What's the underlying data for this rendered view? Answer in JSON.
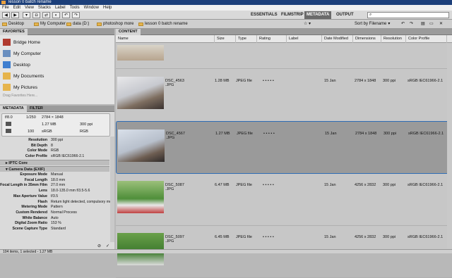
{
  "window": {
    "title": "lesson 0 batch rename"
  },
  "menu": [
    "File",
    "Edit",
    "View",
    "Stacks",
    "Label",
    "Tools",
    "Window",
    "Help"
  ],
  "workspaces": [
    "ESSENTIALS",
    "FILMSTRIP",
    "METADATA",
    "OUTPUT"
  ],
  "active_workspace": "METADATA",
  "sort_label": "Sort by Filename",
  "path": [
    "Desktop",
    "My Computer",
    "data (D:)",
    "photoshop more",
    "lesson 0 batch rename"
  ],
  "favorites": {
    "tab": "FAVORITES",
    "items": [
      "Bridge Home",
      "My Computer",
      "Desktop",
      "My Documents",
      "My Pictures"
    ],
    "hint": "Drag Favorites Here..."
  },
  "metapanel": {
    "tabs": [
      "METADATA",
      "FILTER"
    ],
    "summary": {
      "aperture": "f/8.0",
      "shutter": "1/250",
      "dims": "2784 × 1848",
      "size": "1.27 MB",
      "ppi": "300 ppi",
      "iso": "100",
      "profile": "sRGB",
      "mode": "RGB",
      "ev": "--"
    },
    "file_rows": [
      {
        "k": "Resolution",
        "v": "300 ppi"
      },
      {
        "k": "Bit Depth",
        "v": "8"
      },
      {
        "k": "Color Mode",
        "v": "RGB"
      },
      {
        "k": "Color Profile",
        "v": "sRGB IEC61966-2.1"
      }
    ],
    "iptc": "IPTC Core",
    "camera": "Camera Data (EXIF)",
    "exif_rows": [
      {
        "k": "Exposure Mode",
        "v": "Manual"
      },
      {
        "k": "Focal Length",
        "v": "18.0 mm"
      },
      {
        "k": "Focal Length in 35mm Film",
        "v": "27.0 mm"
      },
      {
        "k": "Lens",
        "v": "18.0-135.0 mm f/3.5-5.6"
      },
      {
        "k": "Max Aperture Value",
        "v": "f/3.5"
      },
      {
        "k": "Flash",
        "v": "Return light detected, compulsory mode"
      },
      {
        "k": "Metering Mode",
        "v": "Pattern"
      },
      {
        "k": "Custom Rendered",
        "v": "Normal Process"
      },
      {
        "k": "White Balance",
        "v": "Auto"
      },
      {
        "k": "Digital Zoom Ratio",
        "v": "153 %"
      },
      {
        "k": "Scene Capture Type",
        "v": "Standard"
      }
    ]
  },
  "content": {
    "tab": "CONTENT",
    "columns": [
      "Name",
      "Size",
      "Type",
      "Rating",
      "Label",
      "Date Modified",
      "Dimensions",
      "Resolution",
      "Color Profile"
    ],
    "rows": [
      {
        "name": "DSC_4563",
        "ext": ".JPG",
        "size": "1.28 MB",
        "type": "JPEG file",
        "rating": "• • • • •",
        "date": "15 Jan",
        "dims": "2784 x 1848",
        "res": "300 ppi",
        "profile": "sRGB IEC61966-2.1"
      },
      {
        "name": "DSC_4567",
        "ext": ".JPG",
        "size": "1.27 MB",
        "type": "JPEG file",
        "rating": "• • • • •",
        "date": "15 Jan",
        "dims": "2784 x 1848",
        "res": "300 ppi",
        "profile": "sRGB IEC61966-2.1"
      },
      {
        "name": "DSC_5087",
        "ext": ".JPG",
        "size": "6.47 MB",
        "type": "JPEG file",
        "rating": "• • • • •",
        "date": "15 Jan",
        "dims": "4256 x 2832",
        "res": "300 ppi",
        "profile": "sRGB IEC61966-2.1"
      },
      {
        "name": "DSC_5097",
        "ext": ".JPG",
        "size": "6.45 MB",
        "type": "JPEG file",
        "rating": "• • • • •",
        "date": "15 Jan",
        "dims": "4256 x 2832",
        "res": "300 ppi",
        "profile": "sRGB IEC61966-2.1"
      }
    ]
  },
  "status": "104 items, 1 selected - 1.27 MB"
}
